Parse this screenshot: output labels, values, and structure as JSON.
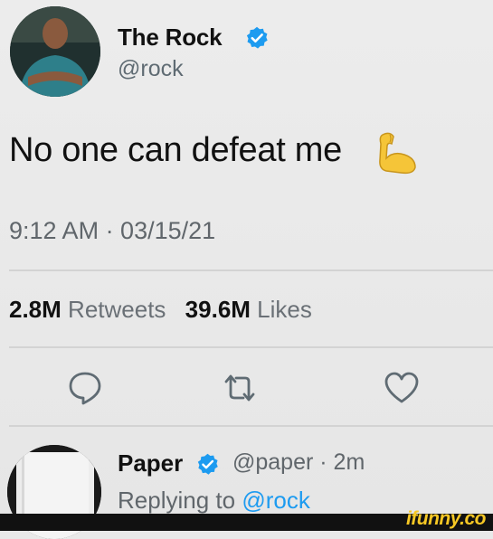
{
  "tweet": {
    "author_name": "The Rock",
    "author_handle": "@rock",
    "text": "No one can defeat me",
    "emoji": "flexed-biceps",
    "timestamp": "9:12 AM · 03/15/21",
    "retweets_count": "2.8M",
    "retweets_label": "Retweets",
    "likes_count": "39.6M",
    "likes_label": "Likes"
  },
  "reply": {
    "author_name": "Paper",
    "author_handle_time": "@paper · 2m",
    "replying_prefix": "Replying to",
    "replying_mention": "@rock"
  },
  "watermark": "ifunny.co",
  "icons": [
    "verified-badge-icon",
    "reply-icon",
    "retweet-icon",
    "like-icon",
    "flexed-biceps-icon"
  ],
  "colors": {
    "accent": "#1d9bf0",
    "secondary_text": "#60666b",
    "background": "#e9e9e9"
  }
}
